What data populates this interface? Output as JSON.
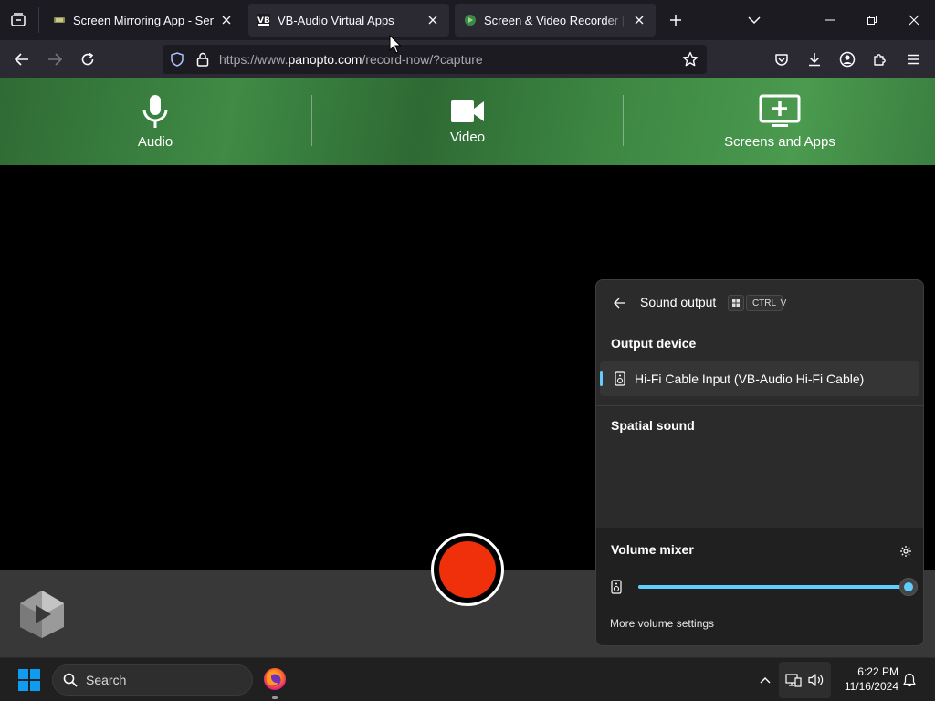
{
  "browser": {
    "tabs": [
      {
        "title": "Screen Mirroring App - Sender",
        "active": false
      },
      {
        "title": "VB-Audio Virtual Apps",
        "active": true
      },
      {
        "title": "Screen & Video Recorder | Panopto",
        "active": false
      }
    ],
    "url": {
      "prefix": "https://www.",
      "host": "panopto.com",
      "path": "/record-now/?capture"
    }
  },
  "capture": {
    "items": [
      {
        "label": "Audio",
        "icon": "microphone-icon"
      },
      {
        "label": "Video",
        "icon": "video-camera-icon"
      },
      {
        "label": "Screens and Apps",
        "icon": "screen-add-icon"
      }
    ]
  },
  "flyout": {
    "title": "Sound output",
    "shortcut": [
      "CTRL",
      "V"
    ],
    "output_section": "Output device",
    "device_name": "Hi-Fi Cable Input (VB-Audio Hi-Fi Cable)",
    "spatial_section": "Spatial sound",
    "mixer_section": "Volume mixer",
    "volume_level": 1.0,
    "more_settings": "More volume settings",
    "accent": "#60cdff"
  },
  "recorder": {
    "record_color": "#f0300a"
  },
  "taskbar": {
    "search_placeholder": "Search",
    "time": "6:22 PM",
    "date": "11/16/2024"
  },
  "colors": {
    "tabbar": "#1c1b22",
    "toolbar": "#2b2a33",
    "capture_green": "#3f8a45"
  }
}
